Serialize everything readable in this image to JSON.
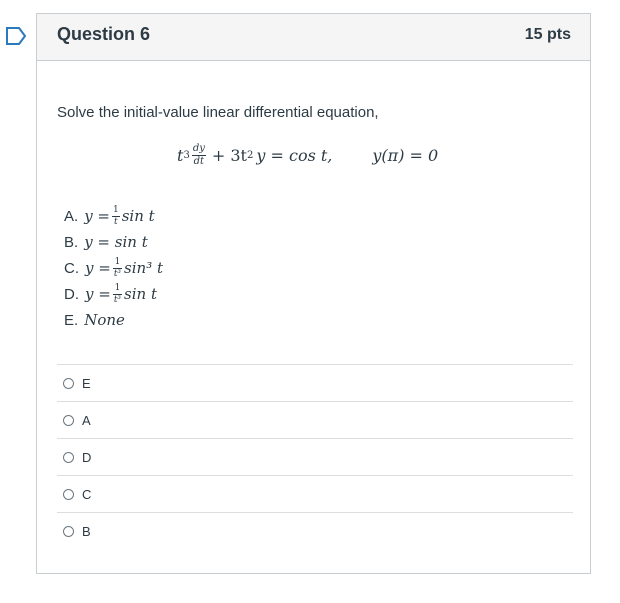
{
  "icons": {
    "bookmark": "bookmark-icon"
  },
  "colors": {
    "accent": "#2b7abc",
    "header_bg": "#f5f5f5",
    "border": "#c7cdd1",
    "text": "#2d3b45"
  },
  "question": {
    "title": "Question 6",
    "points": "15 pts",
    "prompt": "Solve the initial-value linear differential equation,",
    "equation": {
      "lhs_prefix": "t",
      "lhs_exp": "3",
      "dy": "dy",
      "dt": "dt",
      "plus_term": "+ 3t",
      "plus_exp": "2",
      "rest": "y = cos t,",
      "condition": "y(π) = 0"
    },
    "choices": [
      {
        "label": "A.",
        "pre": "y =",
        "num": "1",
        "den": "t",
        "post": "sin t"
      },
      {
        "label": "B.",
        "pre": "y = sin t"
      },
      {
        "label": "C.",
        "pre": "y =",
        "num": "1",
        "den": "t³",
        "post": "sin³ t"
      },
      {
        "label": "D.",
        "pre": "y =",
        "num": "1",
        "den": "t³",
        "post": "sin t"
      },
      {
        "label": "E.",
        "pre": "None"
      }
    ],
    "answers": [
      "E",
      "A",
      "D",
      "C",
      "B"
    ]
  }
}
